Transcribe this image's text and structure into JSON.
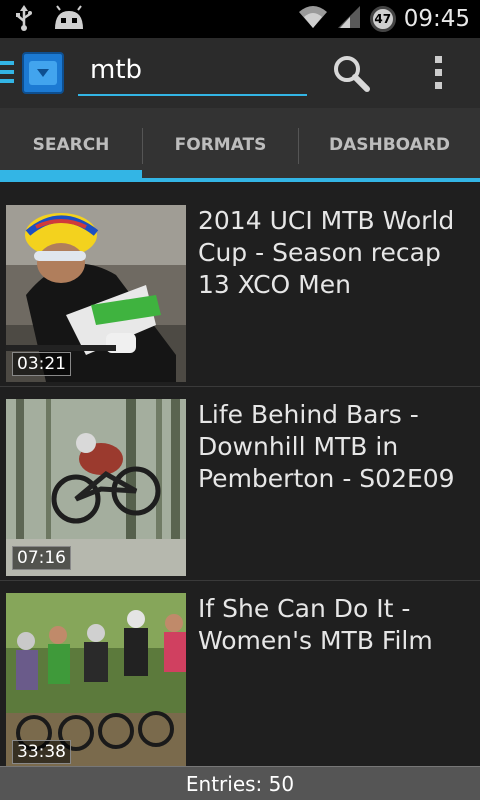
{
  "status_bar": {
    "time": "09:45",
    "battery_level": "47",
    "icons": [
      "usb-icon",
      "android-debug-icon",
      "wifi-icon",
      "signal-icon",
      "battery-icon"
    ]
  },
  "action_bar": {
    "search_value": "mtb",
    "accent_color": "#33b5e5"
  },
  "tabs": [
    {
      "label": "SEARCH",
      "selected": true
    },
    {
      "label": "FORMATS",
      "selected": false
    },
    {
      "label": "DASHBOARD",
      "selected": false
    }
  ],
  "results": [
    {
      "title": "2014 UCI MTB World Cup - Season recap 13 XCO Men",
      "duration": "03:21"
    },
    {
      "title": "Life Behind Bars - Downhill MTB in Pemberton - S02E09",
      "duration": "07:16"
    },
    {
      "title": "If She Can Do It - Women's MTB Film",
      "duration": "33:38"
    }
  ],
  "footer": {
    "entries_label": "Entries: 50"
  }
}
